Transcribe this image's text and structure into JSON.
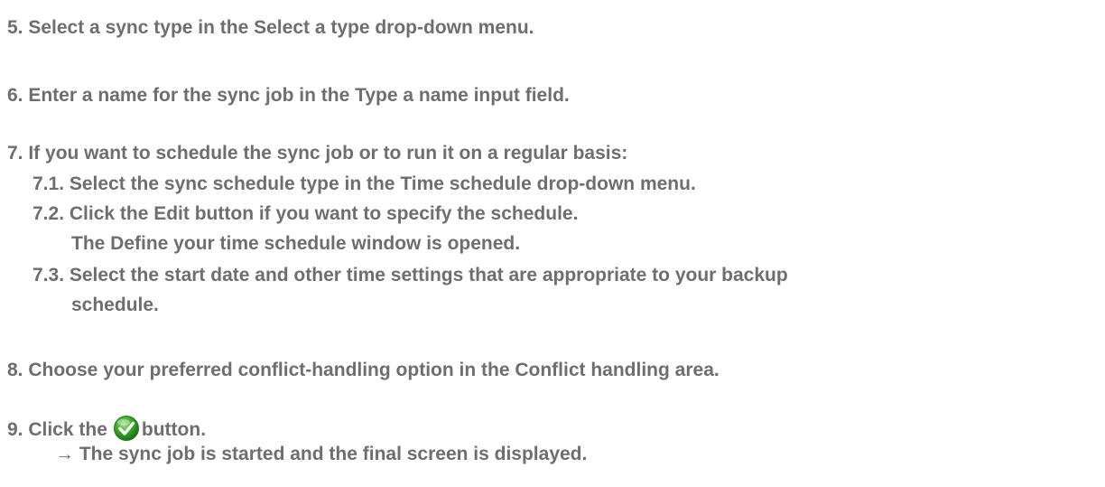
{
  "steps": {
    "s5": "5. Select a sync type in the Select a type drop-down menu.",
    "s6": "6. Enter a name for the sync job in the Type a name input field.",
    "s7": "7. If you want to schedule the sync job or to run it on a regular basis:",
    "s7_1": "7.1. Select the sync schedule type in the Time schedule drop-down menu.",
    "s7_2": "7.2. Click the Edit button if you want to specify the schedule.",
    "s7_2_note": "The Define your time schedule window is opened.",
    "s7_3": "7.3. Select the start date and other time settings that are appropriate to your backup",
    "s7_3_cont": "schedule.",
    "s8": "8. Choose your preferred conflict-handling option in the Conflict handling area.",
    "s9_prefix": "9. Click the",
    "s9_suffix": "button.",
    "s9_icon": "green-checkmark-icon",
    "result": "→ The sync job is started and the final screen is displayed."
  },
  "colors": {
    "text": "#6e6e6e",
    "check_green": "#3aa52a"
  }
}
